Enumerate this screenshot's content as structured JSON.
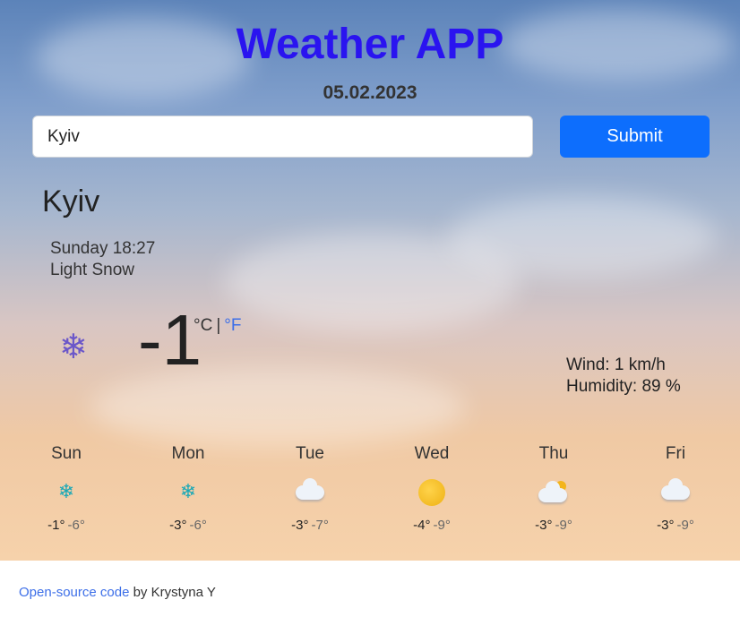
{
  "header": {
    "title": "Weather APP",
    "date": "05.02.2023"
  },
  "search": {
    "value": "Kyiv",
    "placeholder": "",
    "submit_label": "Submit"
  },
  "current": {
    "city": "Kyiv",
    "datetime": "Sunday 18:27",
    "description": "Light Snow",
    "icon": "snowflake-icon",
    "temperature": "-1",
    "unit_celsius": "°C",
    "unit_separator": "|",
    "unit_fahrenheit": "°F",
    "wind": "Wind: 1 km/h",
    "humidity": "Humidity: 89 %"
  },
  "forecast": [
    {
      "day": "Sun",
      "icon": "snowflake-icon",
      "max": "-1°",
      "min": "-6°"
    },
    {
      "day": "Mon",
      "icon": "snowflake-icon",
      "max": "-3°",
      "min": "-6°"
    },
    {
      "day": "Tue",
      "icon": "cloud-icon",
      "max": "-3°",
      "min": "-7°"
    },
    {
      "day": "Wed",
      "icon": "sun-icon",
      "max": "-4°",
      "min": "-9°"
    },
    {
      "day": "Thu",
      "icon": "partly-cloudy-icon",
      "max": "-3°",
      "min": "-9°"
    },
    {
      "day": "Fri",
      "icon": "cloud-icon",
      "max": "-3°",
      "min": "-9°"
    }
  ],
  "footer": {
    "link_text": "Open-source code",
    "author_text": " by Krystyna Y"
  },
  "colors": {
    "title": "#2a14f0",
    "button": "#0d6efd",
    "link": "#3d6fe8"
  }
}
